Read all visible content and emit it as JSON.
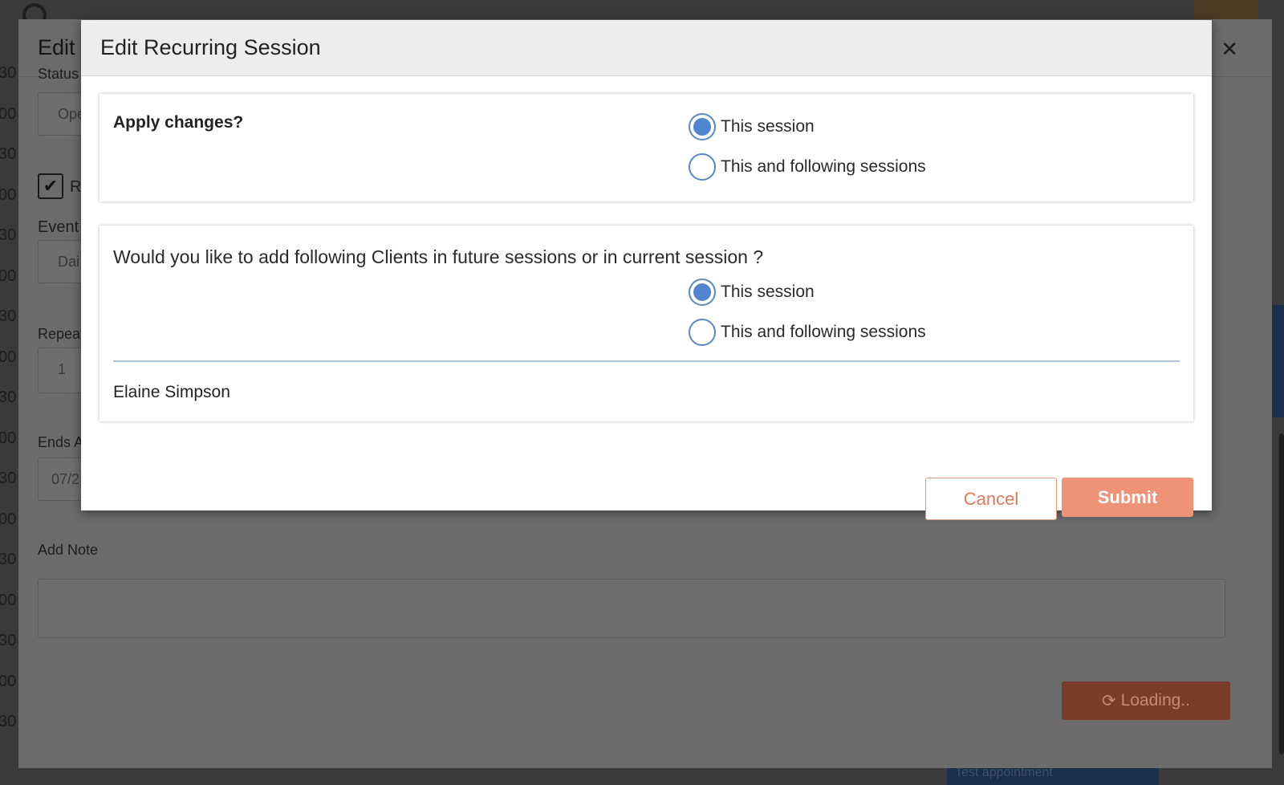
{
  "background": {
    "time_labels": [
      "30",
      "00",
      "30",
      "00",
      "30",
      "00",
      "30",
      "00",
      "30",
      "00",
      "30",
      "00",
      "30",
      "00",
      "30",
      "00",
      "30"
    ],
    "event_strip_text": "Test appointment"
  },
  "edit_modal": {
    "title": "Edit",
    "status_label": "Status",
    "status_value": "Ope",
    "recurring_check_label": "R",
    "event_label": "Event",
    "event_value": "Dai",
    "repeat_label": "Repeat",
    "repeat_value": "1",
    "ends_label": "Ends A",
    "ends_value": "07/2",
    "note_label": "Add Note",
    "loading_label": "Loading.."
  },
  "dialog": {
    "title": "Edit Recurring Session",
    "apply": {
      "label": "Apply changes?",
      "options": [
        {
          "label": "This session",
          "selected": true
        },
        {
          "label": "This and following sessions",
          "selected": false
        }
      ]
    },
    "clients": {
      "question": "Would you like to add following Clients in future sessions or in current session ?",
      "options": [
        {
          "label": "This session",
          "selected": true
        },
        {
          "label": "This and following sessions",
          "selected": false
        }
      ],
      "names": [
        "Elaine Simpson"
      ]
    },
    "cancel_label": "Cancel",
    "submit_label": "Submit"
  },
  "colors": {
    "accent": "#ee9378",
    "radio": "#4f86cf",
    "divider": "#a9c7e2"
  }
}
